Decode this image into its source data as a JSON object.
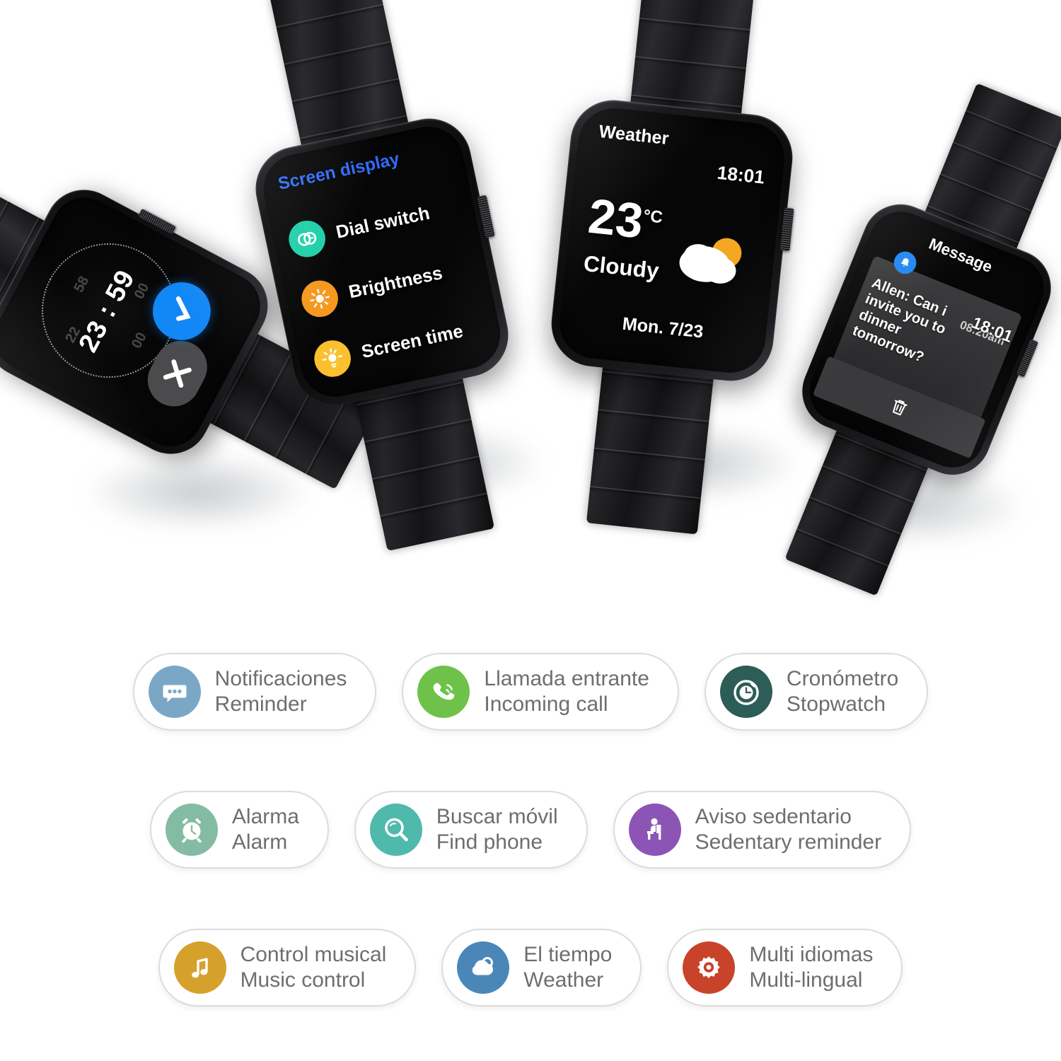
{
  "watches": [
    {
      "id": "alarm",
      "screen_type": "alarm-dismiss",
      "time": "23 : 59",
      "ghost_digits": [
        "22",
        "58",
        "00",
        "00"
      ],
      "accept_icon": "check-icon",
      "dismiss_icon": "close-icon",
      "accept_color": "#1287f6",
      "dismiss_color": "#4b4b4d"
    },
    {
      "id": "screen-display",
      "screen_type": "settings-menu",
      "title": "Screen display",
      "title_color": "#2f6dfb",
      "items": [
        {
          "label": "Dial switch",
          "icon": "dial-switch-icon",
          "color": "#1ecfa8"
        },
        {
          "label": "Brightness",
          "icon": "brightness-sun-icon",
          "color": "#f5981e"
        },
        {
          "label": "Screen time",
          "icon": "screen-time-sun-icon",
          "color": "#fbc02d"
        }
      ]
    },
    {
      "id": "weather",
      "screen_type": "weather",
      "title": "Weather",
      "time": "18:01",
      "temperature": "23",
      "unit": "°C",
      "condition": "Cloudy",
      "date": "Mon.  7/23",
      "icon": "cloud-sun-icon",
      "sun_color": "#f5a623"
    },
    {
      "id": "message",
      "screen_type": "message",
      "title": "Message",
      "time": "18:01",
      "bell_icon": "bell-icon",
      "bell_color": "#1e88f0",
      "sender": "Allen:",
      "body": "Can i invite you to dinner tomorrow?",
      "stamp": "08:20am",
      "delete_icon": "trash-icon"
    }
  ],
  "features": [
    {
      "es": "Notificaciones",
      "en": "Reminder",
      "icon": "chat-bubble-icon",
      "color": "#7ba7c7"
    },
    {
      "es": "Llamada entrante",
      "en": "Incoming call",
      "icon": "phone-call-icon",
      "color": "#6ec24a"
    },
    {
      "es": "Cronómetro",
      "en": "Stopwatch",
      "icon": "stopwatch-icon",
      "color": "#२"
    },
    {
      "es": "Alarma",
      "en": "Alarm",
      "icon": "alarm-clock-icon",
      "color": "#84bba4"
    },
    {
      "es": "Buscar móvil",
      "en": "Find phone",
      "icon": "magnifier-icon",
      "color": "#4fb9ab"
    },
    {
      "es": "Aviso sedentario",
      "en": "Sedentary reminder",
      "icon": "sedentary-person-icon",
      "color": "#8c55b5"
    },
    {
      "es": "Control musical",
      "en": "Music control",
      "icon": "music-note-icon",
      "color": "#d5a12c"
    },
    {
      "es": "El tiempo",
      "en": "Weather",
      "icon": "cloud-icon",
      "color": "#4a87b8"
    },
    {
      "es": "Multi idiomas",
      "en": "Multi-lingual",
      "icon": "gear-icon",
      "color": "#c8432a"
    }
  ]
}
